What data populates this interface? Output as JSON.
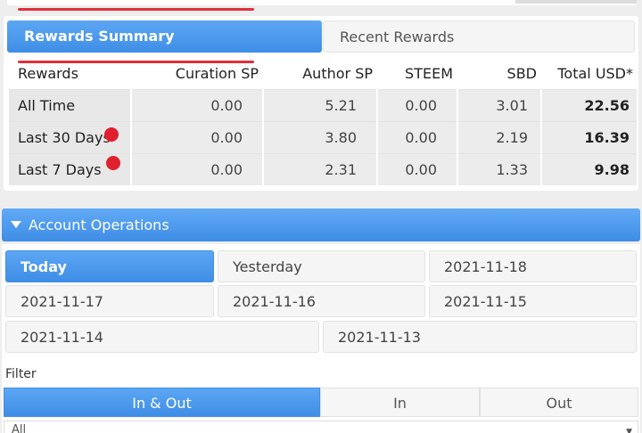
{
  "rewards_tabs": {
    "summary_label": "Rewards Summary",
    "recent_label": "Recent Rewards"
  },
  "rewards_table": {
    "headers": [
      "Rewards",
      "Curation SP",
      "Author SP",
      "STEEM",
      "SBD",
      "Total USD*"
    ],
    "rows": [
      {
        "label": "All Time",
        "curation": "0.00",
        "author": "5.21",
        "steem": "0.00",
        "sbd": "3.01",
        "total": "22.56"
      },
      {
        "label": "Last 30 Days",
        "curation": "0.00",
        "author": "3.80",
        "steem": "0.00",
        "sbd": "2.19",
        "total": "16.39"
      },
      {
        "label": "Last 7 Days",
        "curation": "0.00",
        "author": "2.31",
        "steem": "0.00",
        "sbd": "1.33",
        "total": "9.98"
      }
    ]
  },
  "account_operations": {
    "title": "Account Operations",
    "dates": [
      "Today",
      "Yesterday",
      "2021-11-18",
      "2021-11-17",
      "2021-11-16",
      "2021-11-15",
      "2021-11-14",
      "2021-11-13"
    ]
  },
  "filter": {
    "label": "Filter",
    "options": [
      "In & Out",
      "In",
      "Out"
    ],
    "select_value": "All"
  },
  "colors": {
    "accent": "#4a98ec",
    "annotation_red": "#e0303a"
  }
}
